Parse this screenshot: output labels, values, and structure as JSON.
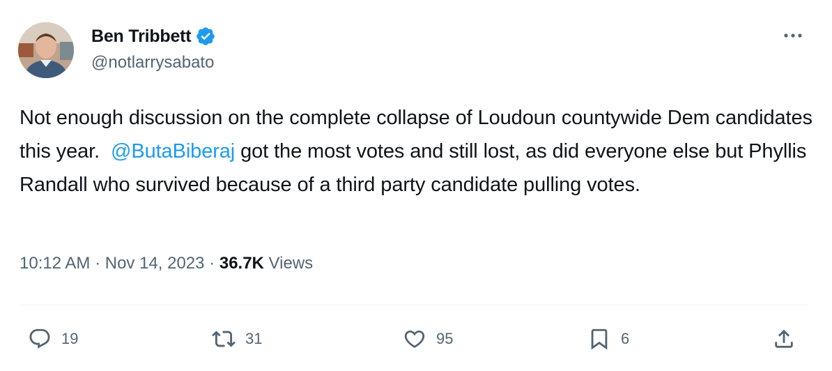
{
  "author": {
    "display_name": "Ben Tribbett",
    "handle": "@notlarrysabato",
    "verified_icon": "verified-badge-icon"
  },
  "tweet": {
    "text_before_mention": "Not enough discussion on the complete collapse of Loudoun countywide Dem candidates this year.  ",
    "mention": "@ButaBiberaj",
    "text_after_mention": " got the most votes and still lost, as did everyone else but Phyllis Randall who survived because of a third party candidate pulling votes."
  },
  "meta": {
    "time": "10:12 AM",
    "separator": " · ",
    "date": "Nov 14, 2023",
    "views_count": "36.7K",
    "views_label": " Views"
  },
  "actions": {
    "replies": "19",
    "reposts": "31",
    "likes": "95",
    "bookmarks": "6"
  },
  "colors": {
    "accent": "#1d9bf0",
    "secondary_text": "#536471",
    "primary_text": "#0f1419",
    "divider": "#eff3f4"
  }
}
